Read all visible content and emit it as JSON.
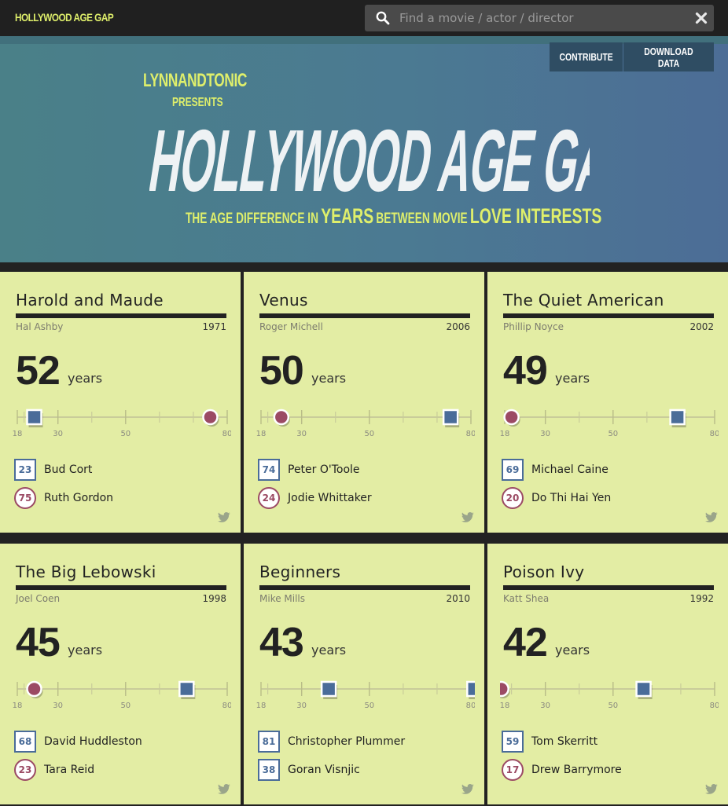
{
  "header": {
    "brand": "HOLLYWOOD AGE GAP",
    "search_placeholder": "Find a movie / actor / director"
  },
  "hero": {
    "presenter": "LYNNANDTONIC",
    "presents": "PRESENTS",
    "title": "HOLLYWOOD AGE GAP",
    "tagline_1": "THE AGE DIFFERENCE IN",
    "tagline_2": "YEARS",
    "tagline_3": "BETWEEN MOVIE",
    "tagline_4": "LOVE INTERESTS",
    "contribute_label": "CONTRIBUTE",
    "download_label": "DOWNLOAD DATA"
  },
  "colors": {
    "accent": "#dfef6b",
    "card_bg": "#e3eda4",
    "male": "#4a6c99",
    "female": "#9b4a64",
    "background": "#222222"
  },
  "icons": [
    "search-icon",
    "close-icon",
    "twitter-icon"
  ],
  "scale": {
    "min": 18,
    "max": 80,
    "ticks": [
      18,
      30,
      50,
      80
    ]
  },
  "unit_label": "years",
  "movies": [
    {
      "title": "Harold and Maude",
      "director": "Hal Ashby",
      "year": "1971",
      "gap": "52",
      "people": [
        {
          "name": "Bud Cort",
          "age": 23,
          "gender": "m"
        },
        {
          "name": "Ruth Gordon",
          "age": 75,
          "gender": "f"
        }
      ]
    },
    {
      "title": "Venus",
      "director": "Roger Michell",
      "year": "2006",
      "gap": "50",
      "people": [
        {
          "name": "Peter O'Toole",
          "age": 74,
          "gender": "m"
        },
        {
          "name": "Jodie Whittaker",
          "age": 24,
          "gender": "f"
        }
      ]
    },
    {
      "title": "The Quiet American",
      "director": "Phillip Noyce",
      "year": "2002",
      "gap": "49",
      "people": [
        {
          "name": "Michael Caine",
          "age": 69,
          "gender": "m"
        },
        {
          "name": "Do Thi Hai Yen",
          "age": 20,
          "gender": "f"
        }
      ]
    },
    {
      "title": "The Big Lebowski",
      "director": "Joel Coen",
      "year": "1998",
      "gap": "45",
      "people": [
        {
          "name": "David Huddleston",
          "age": 68,
          "gender": "m"
        },
        {
          "name": "Tara Reid",
          "age": 23,
          "gender": "f"
        }
      ]
    },
    {
      "title": "Beginners",
      "director": "Mike Mills",
      "year": "2010",
      "gap": "43",
      "people": [
        {
          "name": "Christopher Plummer",
          "age": 81,
          "gender": "m"
        },
        {
          "name": "Goran Visnjic",
          "age": 38,
          "gender": "m"
        }
      ]
    },
    {
      "title": "Poison Ivy",
      "director": "Katt Shea",
      "year": "1992",
      "gap": "42",
      "people": [
        {
          "name": "Tom Skerritt",
          "age": 59,
          "gender": "m"
        },
        {
          "name": "Drew Barrymore",
          "age": 17,
          "gender": "f"
        }
      ]
    }
  ]
}
